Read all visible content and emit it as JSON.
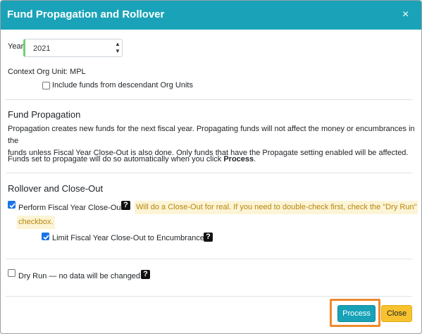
{
  "dialog": {
    "title": "Fund Propagation and Rollover",
    "close_symbol": "×"
  },
  "year": {
    "label": "Year",
    "value": "2021"
  },
  "context": {
    "label": "Context Org Unit: MPL",
    "include_descendants_label": "Include funds from descendant Org Units",
    "include_descendants_checked": false
  },
  "propagation": {
    "heading": "Fund Propagation",
    "line1": "Propagation creates new funds for the next fiscal year. Propagating funds will not affect the money or encumbrances in the",
    "line2": "funds unless Fiscal Year Close-Out is also done. Only funds that have the Propagate setting enabled will be affected.",
    "note_prefix": "Funds set to propagate will do so automatically when you click ",
    "note_bold": "Process",
    "note_suffix": "."
  },
  "rollover": {
    "heading": "Rollover and Close-Out",
    "close_out_label": "Perform Fiscal Year Close-Out",
    "close_out_checked": true,
    "warning_line1": "Will do a Close-Out for real. If you need to double-check first, check the \"Dry Run\"",
    "warning_line2": "checkbox.",
    "limit_label": "Limit Fiscal Year Close-Out to Encumbrances",
    "limit_checked": true
  },
  "dry_run": {
    "label": "Dry Run — no data will be changed",
    "checked": false
  },
  "help_symbol": "?",
  "icons": [
    "close-icon",
    "spinner-up-icon",
    "spinner-down-icon",
    "help-icon",
    "checkmark-icon"
  ],
  "buttons": {
    "process": "Process",
    "close": "Close"
  },
  "colors": {
    "header_bg": "#1aa3b8",
    "process_bg": "#17a2b8",
    "close_bg": "#f7c22e",
    "highlight_frame": "#ee8a2f",
    "warning_bg": "#fcf4d6",
    "warning_text": "#b8860b",
    "checkbox_checked": "#1a73e8"
  }
}
